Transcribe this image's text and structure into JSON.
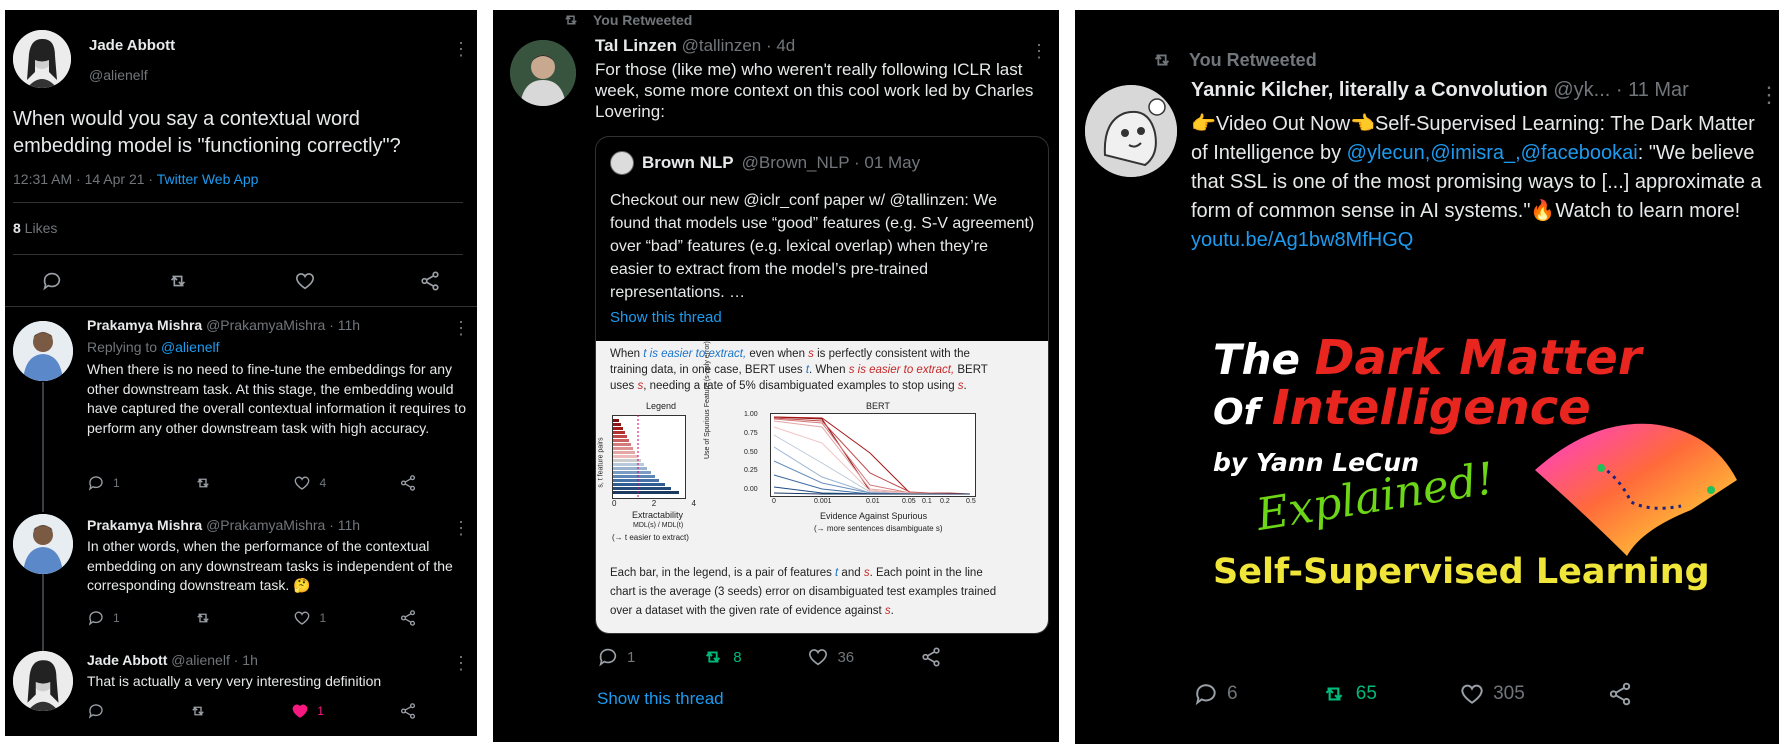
{
  "panel1": {
    "main": {
      "name": "Jade Abbott",
      "handle": "@alienelf",
      "text": "When would you say a contextual word embedding model is \"functioning correctly\"?",
      "time": "12:31 AM · 14 Apr 21 · ",
      "source": "Twitter Web App",
      "likes_count": "8",
      "likes_label": " Likes"
    },
    "replies": [
      {
        "name": "Prakamya Mishra",
        "meta": "@PrakamyaMishra · 11h",
        "replying_prefix": "Replying to ",
        "replying_to": "@alienelf",
        "text": "When there is no need to fine-tune the embeddings for any other downstream task. At this stage, the embedding would have captured the overall contextual information it requires to perform any other downstream task with high accuracy.",
        "reply_count": "1",
        "retweet_count": "",
        "like_count": "4"
      },
      {
        "name": "Prakamya Mishra",
        "meta": "@PrakamyaMishra · 11h",
        "text": "In other words, when the performance of the contextual embedding on any downstream tasks is independent of the corresponding downstream task. 🤔",
        "reply_count": "1",
        "retweet_count": "",
        "like_count": "1"
      },
      {
        "name": "Jade Abbott",
        "meta": "@alienelf · 1h",
        "text": "That is actually a very very interesting definition",
        "reply_count": "",
        "retweet_count": "",
        "like_count": "1"
      }
    ]
  },
  "panel2": {
    "retweeted_label": "You Retweeted",
    "name": "Tal Linzen",
    "meta": "@tallinzen · 4d",
    "text": "For those (like me) who weren't really following ICLR last week, some more context on this cool work led by Charles Lovering:",
    "quote": {
      "name": "Brown NLP",
      "meta": "@Brown_NLP · 01 May",
      "text": "Checkout our new @iclr_conf paper w/ @tallinzen: We found that models use “good” features (e.g. S-V agreement) over “bad” features (e.g. lexical overlap) when they’re easier to extract from the model’s pre-trained representations. …",
      "show_thread": "Show this thread"
    },
    "figure": {
      "intro_1": "When ",
      "intro_t1": "t is easier to extract,",
      "intro_2": " even when ",
      "intro_s1": "s",
      "intro_3": " is perfectly consistent with the",
      "line2_1": "training data, in one case, BERT uses ",
      "line2_t": "t",
      "line2_2": ". When ",
      "line2_s": "s is easier to extract,",
      "line2_3": " BERT",
      "line3_1": "uses ",
      "line3_s": "s",
      "line3_2": ", needing a rate of 5% disambiguated examples to stop using ",
      "line3_s2": "s",
      "line3_3": ".",
      "legend_title": "Legend",
      "bert_title": "BERT",
      "legend_ylabel": "s, t feature pairs",
      "legend_xticks": [
        "0",
        "2",
        "4"
      ],
      "legend_xlabel": "Extractability",
      "legend_xsub": "MDL(s) / MDL(t)",
      "legend_arrow": "(→ t easier to extract)",
      "bert_ylabel": "Use of Spurious Feature (s-only error)",
      "bert_yticks": [
        "1.00",
        "0.75",
        "0.50",
        "0.25",
        "0.00"
      ],
      "bert_xticks": [
        "0",
        "0.001",
        "0.01",
        "0.05",
        "0.1",
        "0.2",
        "0.5"
      ],
      "bert_xlabel": "Evidence Against Spurious",
      "bert_xsub": "(→ more sentences disambiguate s)",
      "caption_1": "Each bar, in the legend, is a pair of features ",
      "caption_t": "t",
      "caption_2": " and ",
      "caption_s": "s",
      "caption_3": ". Each point in the line",
      "caption_line2": "chart is the average (3 seeds) error on disambiguated test examples trained",
      "caption_line3a": "over a dataset with the given rate of evidence against ",
      "caption_line3s": "s",
      "caption_line3b": "."
    },
    "reply_count": "1",
    "retweet_count": "8",
    "like_count": "36",
    "show_thread": "Show this thread"
  },
  "panel3": {
    "retweeted_label": "You Retweeted",
    "name": "Yannic Kilcher, literally a Convolution",
    "meta": "@yk... · 11 Mar",
    "text_1": "👉Video Out Now👈Self-Supervised Learning: The Dark Matter of Intelligence by",
    "mentions": "@ylecun,@imisra_,@facebookai",
    "text_2": ": \"We believe that SSL is one of the most promising ways to [...] approximate a form of common sense in AI systems.\"🔥Watch to learn more!",
    "url": "youtu.be/Ag1bw8MfHGQ",
    "thumb": {
      "the": "The ",
      "dark_matter": "Dark Matter",
      "of": "Of ",
      "intelligence": "Intelligence",
      "by": "by Yann LeCun",
      "explained": "Explained!",
      "ssl": "Self-Supervised Learning"
    },
    "reply_count": "6",
    "retweet_count": "65",
    "like_count": "305"
  },
  "colors": {
    "background": "#000000",
    "link": "#1d9bf0",
    "muted": "#71767b",
    "retweet_green": "#00ba7c",
    "like_pink": "#f91880"
  }
}
